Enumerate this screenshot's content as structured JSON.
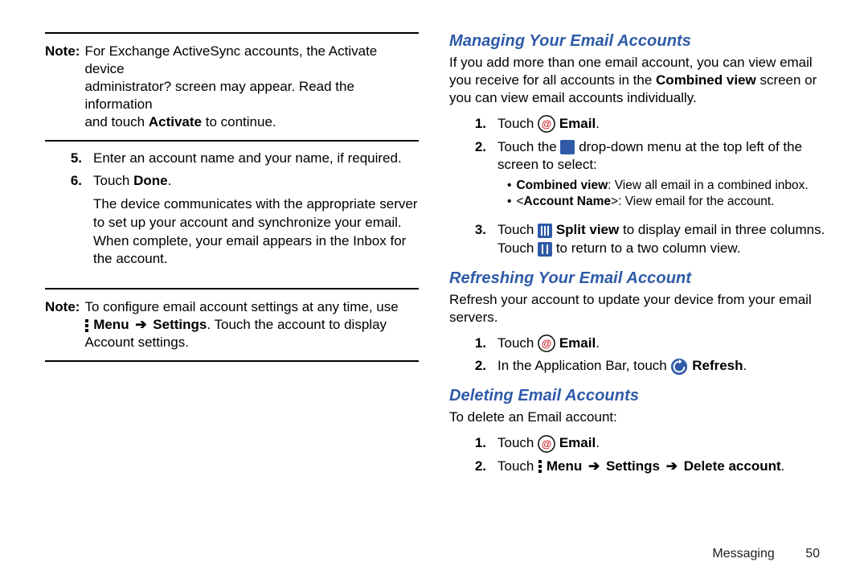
{
  "left": {
    "note1": {
      "label": "Note:",
      "line1_a": "For Exchange ActiveSync accounts, the Activate device",
      "line2": "administrator? screen may appear. Read the information",
      "line3_a": "and touch ",
      "line3_b": "Activate",
      "line3_c": " to continue."
    },
    "step5": {
      "num": "5.",
      "text": "Enter an account name and your name, if required."
    },
    "step6": {
      "num": "6.",
      "t1": "Touch ",
      "t2": "Done",
      "t3": ".",
      "p1": "The device communicates with the appropriate server",
      "p2": "to set up your account and synchronize your email.",
      "p3": "When complete, your email appears in the Inbox for",
      "p4": "the account."
    },
    "note2": {
      "label": "Note:",
      "l1": "To configure email account settings at any time, use",
      "l2_a": " ",
      "l2_b": "Menu",
      "l2_arrow": "➔",
      "l2_c": "Settings",
      "l2_d": ". Touch the account to display",
      "l3": "Account settings."
    }
  },
  "right": {
    "sec1": {
      "head": "Managing Your Email Accounts",
      "p": "If you add more than one email account, you can view email you receive for all accounts in the ",
      "p_b": "Combined view",
      "p_c": " screen or you can view email accounts individually.",
      "s1a": "Touch ",
      "s1b": " Email",
      "s1c": ".",
      "s2a": "Touch the ",
      "s2b": " drop-down menu at the top left of the screen to select:",
      "b1a": "Combined view",
      "b1b": ": View all email in a combined inbox.",
      "b2a": "<",
      "b2b": "Account Name",
      "b2c": ">: View email for the account.",
      "s3a": "Touch ",
      "s3b": " Split view",
      "s3c": " to display email in three columns.",
      "s3d": "Touch ",
      "s3e": " to return to a two column view."
    },
    "sec2": {
      "head": "Refreshing Your Email Account",
      "p": "Refresh your account to update your device from your email servers.",
      "s1a": "Touch ",
      "s1b": " Email",
      "s1c": ".",
      "s2a": "In the Application Bar, touch ",
      "s2b": " Refresh",
      "s2c": "."
    },
    "sec3": {
      "head": "Deleting Email Accounts",
      "p": "To delete an Email account:",
      "s1a": "Touch ",
      "s1b": " Email",
      "s1c": ".",
      "s2a": "Touch ",
      "s2b": " Menu",
      "arrow": "➔",
      "s2c": "Settings",
      "s2d": "Delete account",
      "s2e": "."
    }
  },
  "nums": {
    "n1": "1.",
    "n2": "2.",
    "n3": "3."
  },
  "footer": {
    "section": "Messaging",
    "page": "50"
  }
}
